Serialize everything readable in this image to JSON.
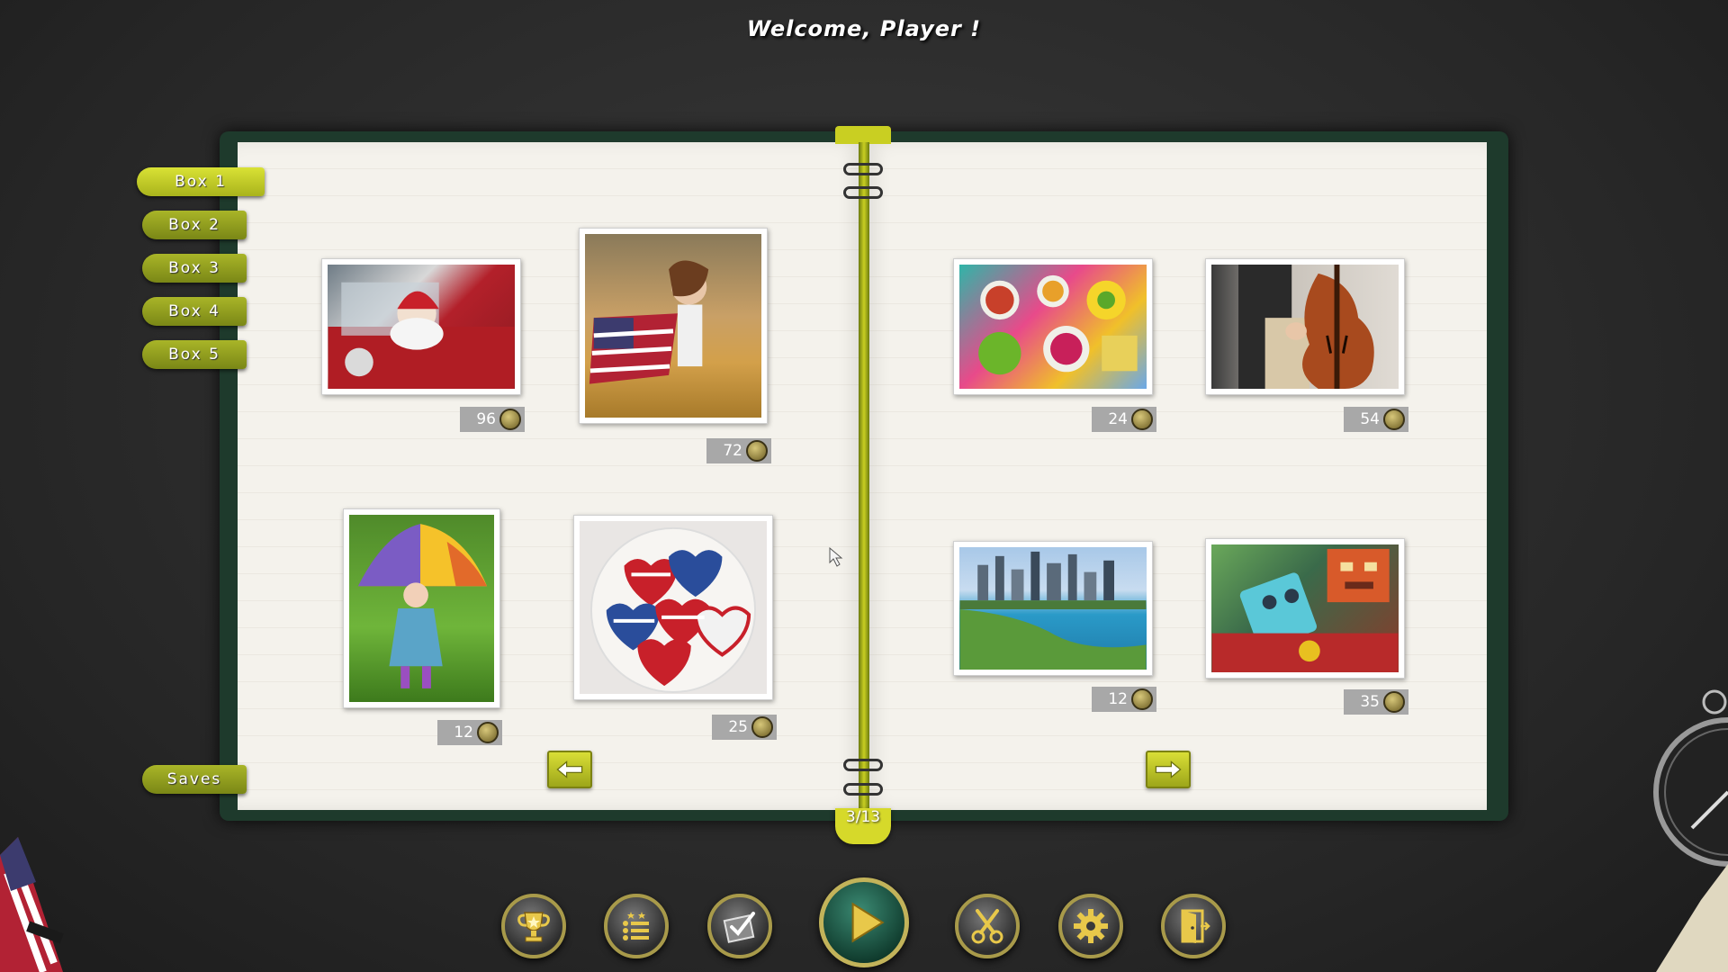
{
  "welcome_text": "Welcome, Player !",
  "tabs": [
    {
      "label": "Box 1",
      "active": true
    },
    {
      "label": "Box 2",
      "active": false
    },
    {
      "label": "Box 3",
      "active": false
    },
    {
      "label": "Box 4",
      "active": false
    },
    {
      "label": "Box 5",
      "active": false
    }
  ],
  "saves_label": "Saves",
  "page_counter": "3/13",
  "puzzles": [
    {
      "subject": "santa-car",
      "pieces": "96"
    },
    {
      "subject": "girl-flag-field",
      "pieces": "72"
    },
    {
      "subject": "girl-umbrella",
      "pieces": "12"
    },
    {
      "subject": "flag-cookies",
      "pieces": "25"
    },
    {
      "subject": "colorful-food",
      "pieces": "24"
    },
    {
      "subject": "double-bass",
      "pieces": "54"
    },
    {
      "subject": "city-skyline",
      "pieces": "12"
    },
    {
      "subject": "toy-robots",
      "pieces": "35"
    }
  ],
  "nav": {
    "prev_icon": "arrow-left-icon",
    "next_icon": "arrow-right-icon"
  },
  "toolbar": [
    "trophy-icon",
    "ranking-list-icon",
    "checklist-icon",
    "play-icon",
    "scissors-icon",
    "gear-icon",
    "exit-door-icon"
  ],
  "colors": {
    "accent": "#c9cf22",
    "book_cover": "#1e3a2c",
    "page": "#f4f2ec",
    "count_bg": "#a8a8a8"
  }
}
